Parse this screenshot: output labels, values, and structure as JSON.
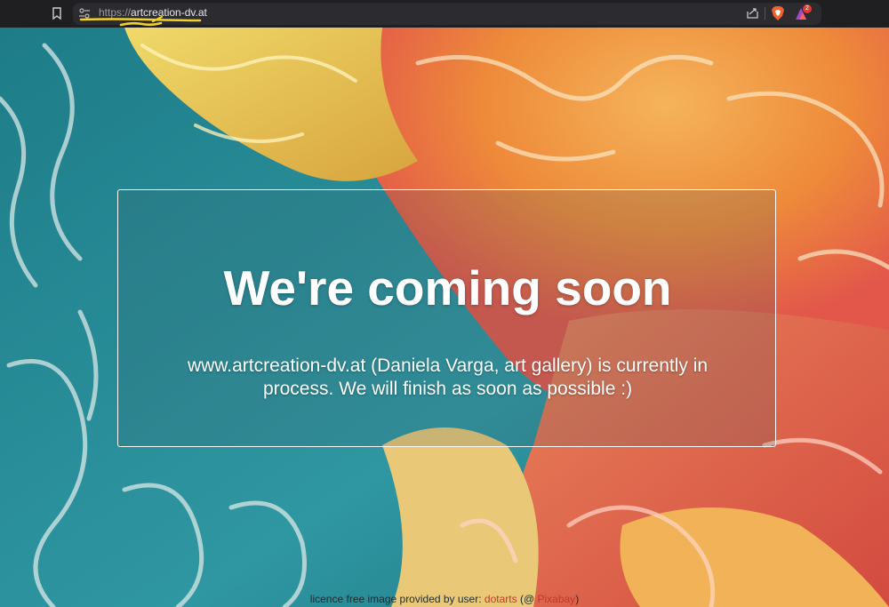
{
  "browser": {
    "url_protocol": "https://",
    "url_domain": "artcreation-dv.at",
    "rewards_badge": "2"
  },
  "panel": {
    "heading": "We're coming soon",
    "description": "www.artcreation-dv.at (Daniela Varga, art gallery) is currently in process. We will finish as soon as possible :)"
  },
  "credit": {
    "prefix": "licence free image provided by user:",
    "user_link": "dotarts",
    "paren_open": "(",
    "site_prefix": "@",
    "site_link": "Pixabay",
    "paren_close": ")"
  },
  "colors": {
    "teal": "#2a8b96",
    "orange": "#ee8a3a",
    "coral": "#e2574a",
    "yellow": "#e8c94a",
    "link": "#c0392b"
  }
}
